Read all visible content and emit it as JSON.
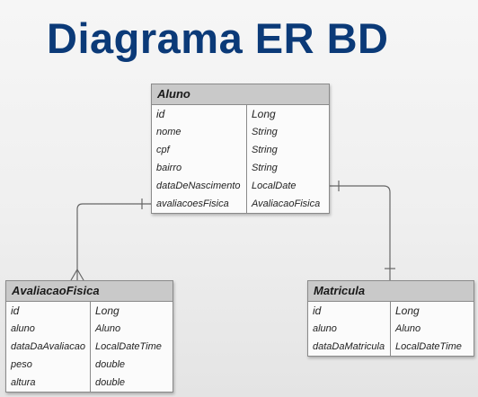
{
  "title": "Diagrama ER BD",
  "entities": {
    "aluno": {
      "name": "Aluno",
      "attributes": [
        {
          "name": "id",
          "type": "Long"
        },
        {
          "name": "nome",
          "type": "String"
        },
        {
          "name": "cpf",
          "type": "String"
        },
        {
          "name": "bairro",
          "type": "String"
        },
        {
          "name": "dataDeNascimento",
          "type": "LocalDate"
        },
        {
          "name": "avaliacoesFisica",
          "type": "AvaliacaoFisica"
        }
      ]
    },
    "avaliacao": {
      "name": "AvaliacaoFisica",
      "attributes": [
        {
          "name": "id",
          "type": "Long"
        },
        {
          "name": "aluno",
          "type": "Aluno"
        },
        {
          "name": "dataDaAvaliacao",
          "type": "LocalDateTime"
        },
        {
          "name": "peso",
          "type": "double"
        },
        {
          "name": "altura",
          "type": "double"
        }
      ]
    },
    "matricula": {
      "name": "Matricula",
      "attributes": [
        {
          "name": "id",
          "type": "Long"
        },
        {
          "name": "aluno",
          "type": "Aluno"
        },
        {
          "name": "dataDaMatricula",
          "type": "LocalDateTime"
        }
      ]
    }
  },
  "relationships": [
    {
      "from": "Aluno",
      "to": "AvaliacaoFisica",
      "from_end": "one",
      "to_end": "many"
    },
    {
      "from": "Aluno",
      "to": "Matricula",
      "from_end": "one",
      "to_end": "one"
    }
  ]
}
